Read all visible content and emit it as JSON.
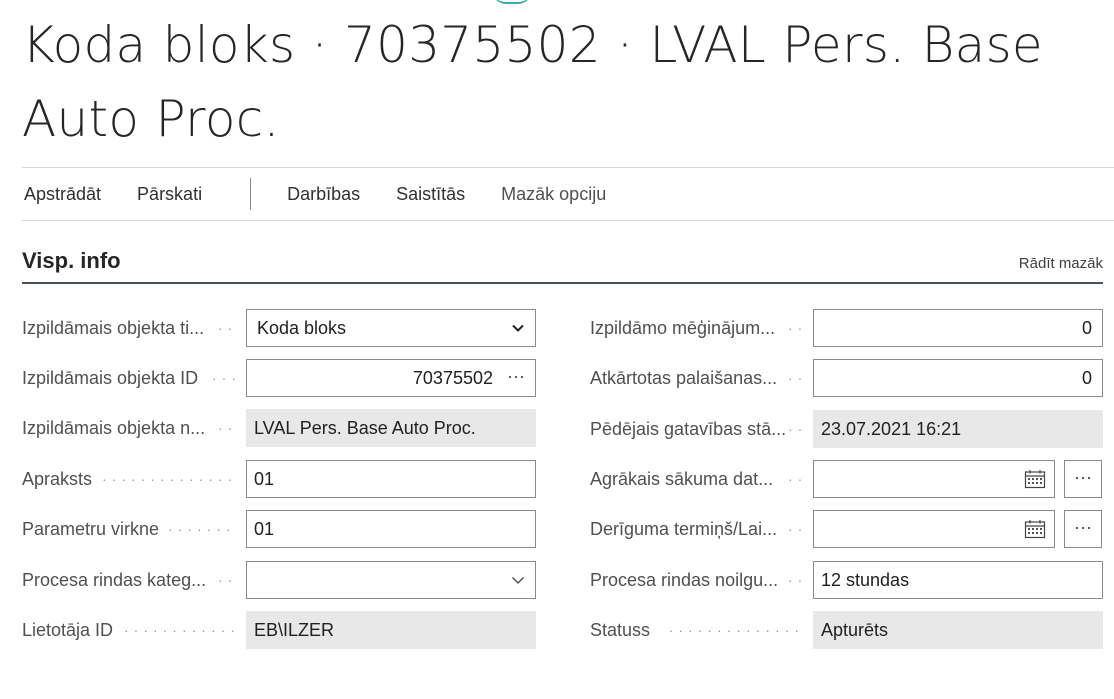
{
  "page": {
    "title": "Koda bloks · 70375502 · LVAL Pers. Base Auto Proc."
  },
  "actions": {
    "process": "Apstrādāt",
    "reports": "Pārskati",
    "actions": "Darbības",
    "related": "Saistītās",
    "fewer_options": "Mazāk opciju"
  },
  "section": {
    "title": "Visp. info",
    "show_less": "Rādīt mazāk"
  },
  "left_fields": {
    "object_type": {
      "label": "Izpildāmais objekta ti...",
      "value": "Koda bloks"
    },
    "object_id": {
      "label": "Izpildāmais objekta ID",
      "value": "70375502",
      "assist": "···"
    },
    "object_name": {
      "label": "Izpildāmais objekta n...",
      "value": "LVAL Pers. Base Auto Proc."
    },
    "description": {
      "label": "Apraksts",
      "value": "01"
    },
    "parameter_string": {
      "label": "Parametru virkne",
      "value": "01"
    },
    "queue_category": {
      "label": "Procesa rindas kateg...",
      "value": ""
    },
    "user_id": {
      "label": "Lietotāja ID",
      "value": "EB\\ILZER"
    }
  },
  "right_fields": {
    "attempts": {
      "label": "Izpildāmo mēģinājum...",
      "value": "0"
    },
    "rerun_delay": {
      "label": "Atkārtotas palaišanas...",
      "value": "0"
    },
    "last_ready_state": {
      "label": "Pēdējais gatavības stā...",
      "value": "23.07.2021 16:21"
    },
    "earliest_start": {
      "label": "Agrākais sākuma dat...",
      "value": "",
      "assist": "···"
    },
    "expiration": {
      "label": "Derīguma termiņš/Lai...",
      "value": "",
      "assist": "···"
    },
    "queue_timeout": {
      "label": "Procesa rindas noilgu...",
      "value": "12 stundas"
    },
    "status": {
      "label": "Statuss",
      "value": "Apturēts"
    }
  },
  "dot_leader": "··············",
  "icons": {
    "dropdown": "chevron-down-icon",
    "calendar": "calendar-icon",
    "ellipsis": "ellipsis-icon"
  },
  "colors": {
    "readonly_bg": "#e8e8e8",
    "border": "#8a8a8a",
    "section_rule": "#4a5058",
    "accent": "#38a9b4"
  }
}
